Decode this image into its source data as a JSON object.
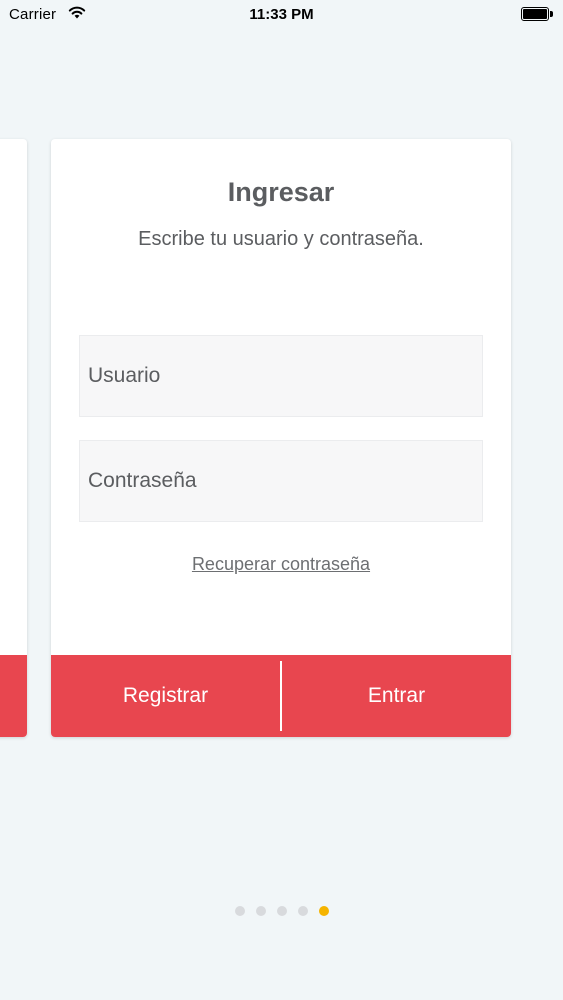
{
  "status_bar": {
    "carrier": "Carrier",
    "time": "11:33 PM"
  },
  "login": {
    "title": "Ingresar",
    "subtitle": "Escribe tu usuario y contraseña.",
    "username_placeholder": "Usuario",
    "password_placeholder": "Contraseña",
    "recover_link": "Recuperar contraseña",
    "register_label": "Registrar",
    "enter_label": "Entrar"
  },
  "pager": {
    "total": 5,
    "active_index": 4
  },
  "colors": {
    "accent": "#e8464f",
    "active_dot": "#f5b400",
    "background": "#f1f6f8"
  }
}
